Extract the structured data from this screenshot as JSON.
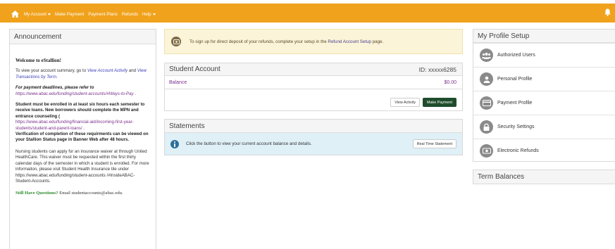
{
  "nav": {
    "items": [
      {
        "label": "My Account",
        "dropdown": true
      },
      {
        "label": "Make Payment",
        "dropdown": false
      },
      {
        "label": "Payment Plans",
        "dropdown": false
      },
      {
        "label": "Refunds",
        "dropdown": false
      },
      {
        "label": "Help",
        "dropdown": true
      }
    ],
    "colors": {
      "bar": "#f0a21c"
    }
  },
  "announcement": {
    "title": "Announcement",
    "welcome": "Welcome to eStallion!",
    "p1_pre": "To view your account summary, go to ",
    "p1_link1": "View Account Activity",
    "p1_mid": " and ",
    "p1_link2": "View Transactions by Term",
    "p1_post": ".",
    "p2_italic": "For payment deadlines, please refer to",
    "p2_url": "https://www.abac.edu/funding/student-accounts/#Ways-to-Pay",
    "p2_post": " .",
    "p3_bold": "Student must be enrolled in at least six hours each semester to receive loans. New borrowers should complete the MPN and entrance counseling (",
    "p3_url": "https://www.abac.edu/funding/financial-aid/incoming-first-year-students/student-and-parent-loans/",
    "p3_sep": " .",
    "p3_bold2": "Verification of completion of these requirments can be viewed on your Stallion Status page in Banner Web after 48 hours.",
    "p4": "Nursing students can apply for an insurance waiver at through United HealthCare. This waiver must be requested within the first thirty calendar days of the semester in which a student is enrolled.  For more informaiton, please visit Student Health Insurance tile under https://www.abac.edu/funding/student-accounts /#InsideABAC-Student-Accounts.",
    "p5_green": "Still Have Questions?",
    "p5_rest": " Email studentaccounts@abac.edu."
  },
  "notice": {
    "pre": "To sign up for direct deposit of your refunds, complete your setup in the ",
    "link": "Refund Account Setup",
    "post": " page."
  },
  "student_account": {
    "title": "Student Account",
    "id": "ID: xxxxx6285",
    "balance_label": "Balance",
    "balance_value": "$0.00",
    "view_activity": "View Activity",
    "make_payment": "Make Payment"
  },
  "statements": {
    "title": "Statements",
    "info": "Click the button to view your current account balance and details.",
    "button": "Real Time Statement"
  },
  "profile_setup": {
    "title": "My Profile Setup",
    "items": [
      {
        "label": "Authorized Users",
        "icon": "users-icon"
      },
      {
        "label": "Personal Profile",
        "icon": "user-icon"
      },
      {
        "label": "Payment Profile",
        "icon": "credit-card-icon"
      },
      {
        "label": "Security Settings",
        "icon": "lock-icon"
      },
      {
        "label": "Electronic Refunds",
        "icon": "money-icon"
      }
    ]
  },
  "term_balances": {
    "title": "Term Balances"
  }
}
